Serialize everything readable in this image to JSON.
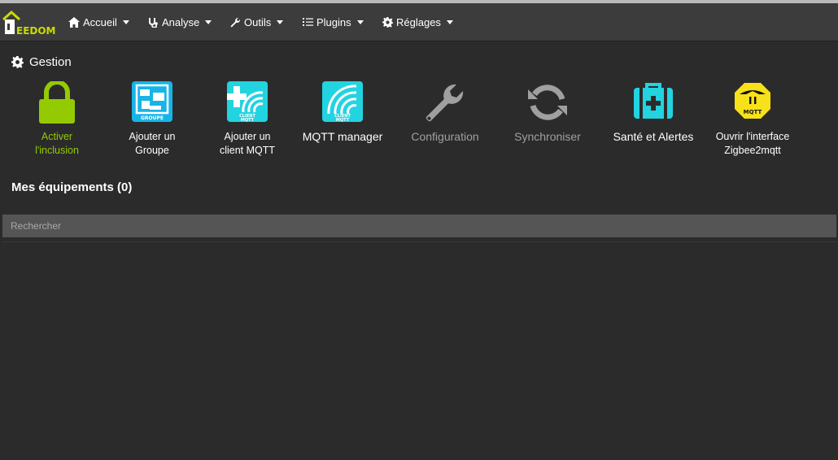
{
  "app": {
    "logo_text": "EEDOM"
  },
  "menu": [
    {
      "label": "Accueil",
      "icon": "home-icon"
    },
    {
      "label": "Analyse",
      "icon": "stethoscope-icon"
    },
    {
      "label": "Outils",
      "icon": "wrench-icon"
    },
    {
      "label": "Plugins",
      "icon": "list-icon"
    },
    {
      "label": "Réglages",
      "icon": "gear-icon"
    }
  ],
  "gestion": {
    "title": "Gestion",
    "tiles": [
      {
        "label": "Activer\nl'inclusion",
        "icon": "lock-icon",
        "color": "#94ca02"
      },
      {
        "label": "Ajouter un\nGroupe",
        "icon": "groupe-icon",
        "color": "#18b4e6",
        "badge": "GROUPE"
      },
      {
        "label": "Ajouter un\nclient MQTT",
        "icon": "add-client-mqtt-icon",
        "color": "#22d3e0",
        "badge": "CLIENT\nMQTT"
      },
      {
        "label": "MQTT manager",
        "icon": "mqtt-manager-icon",
        "color": "#22d3e0",
        "badge": "CLIENT\nMQTT"
      },
      {
        "label": "Configuration",
        "icon": "wrench-icon",
        "color": "#a0a0a0"
      },
      {
        "label": "Synchroniser",
        "icon": "sync-icon",
        "color": "#a0a0a0"
      },
      {
        "label": "Santé et Alertes",
        "icon": "medkit-icon",
        "color": "#22d3e0"
      },
      {
        "label": "Ouvrir l'interface\nZigbee2mqtt",
        "icon": "zigbee2mqtt-icon",
        "color": "#f7e11a",
        "badge": "MQTT"
      }
    ]
  },
  "equipements": {
    "title": "Mes équipements (0)"
  },
  "search": {
    "placeholder": "Rechercher"
  }
}
